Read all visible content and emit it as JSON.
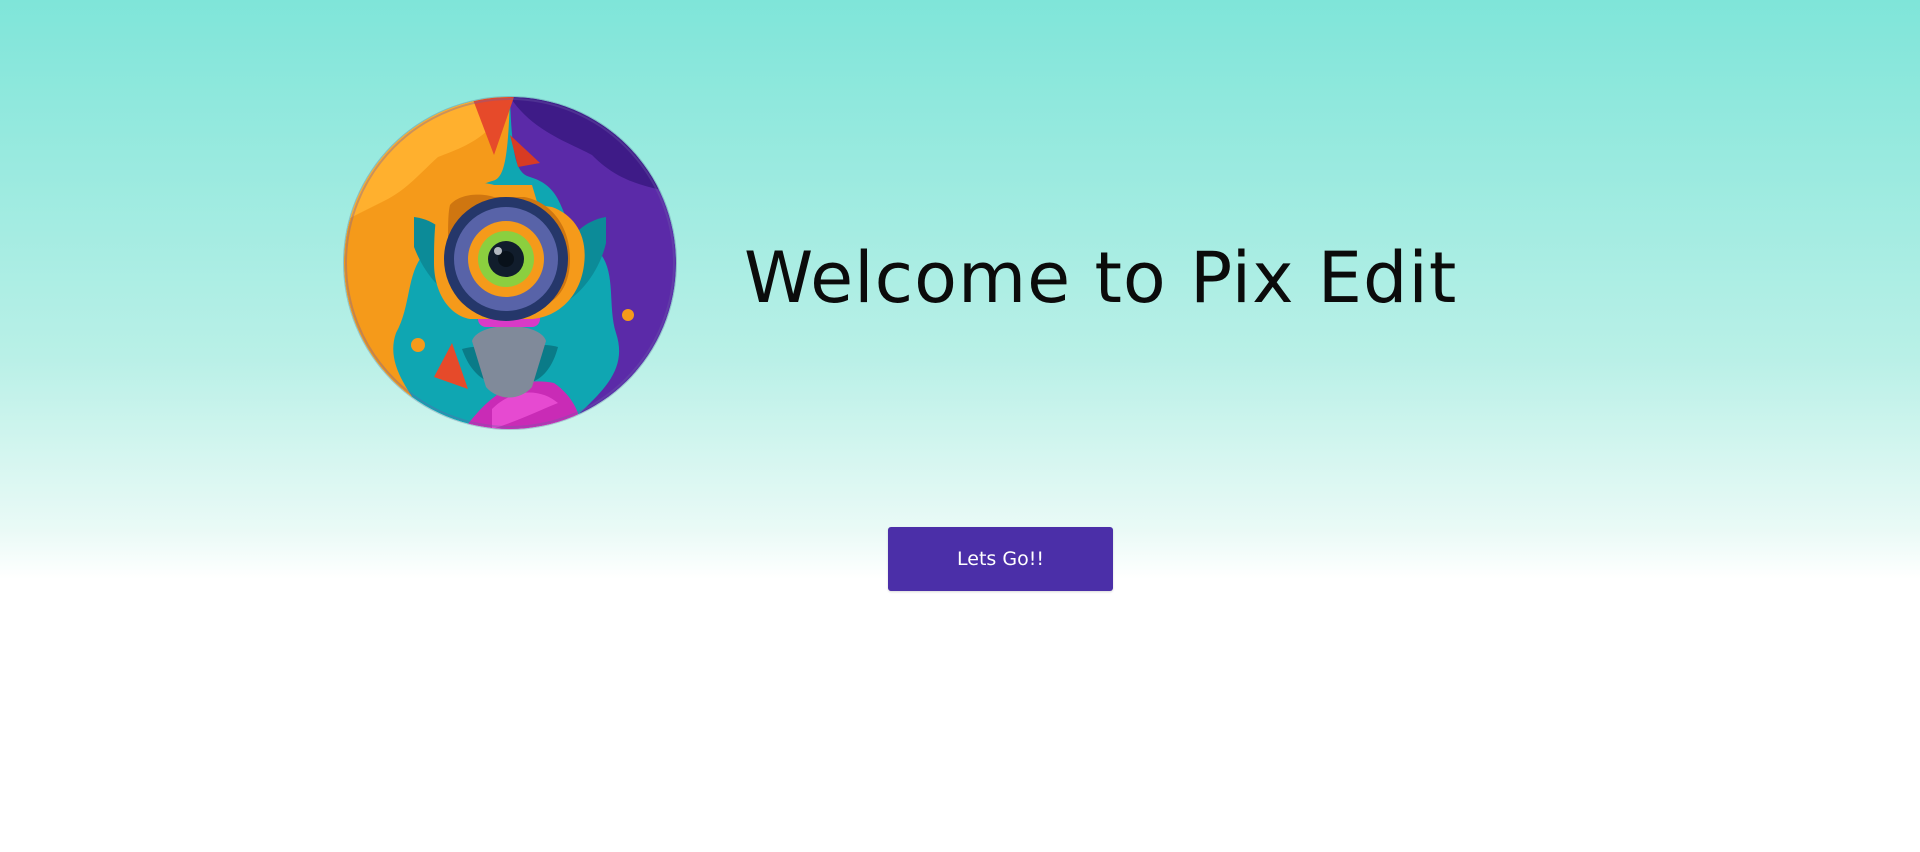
{
  "page": {
    "title": "Welcome to Pix Edit",
    "cta_label": "Lets Go!!"
  },
  "logo": {
    "icon": "camera-flower-logo"
  },
  "colors": {
    "background_top": "#7fe5d9",
    "background_bottom": "#ffffff",
    "button": "#4b2fa8",
    "title_text": "#0b0b0b"
  }
}
